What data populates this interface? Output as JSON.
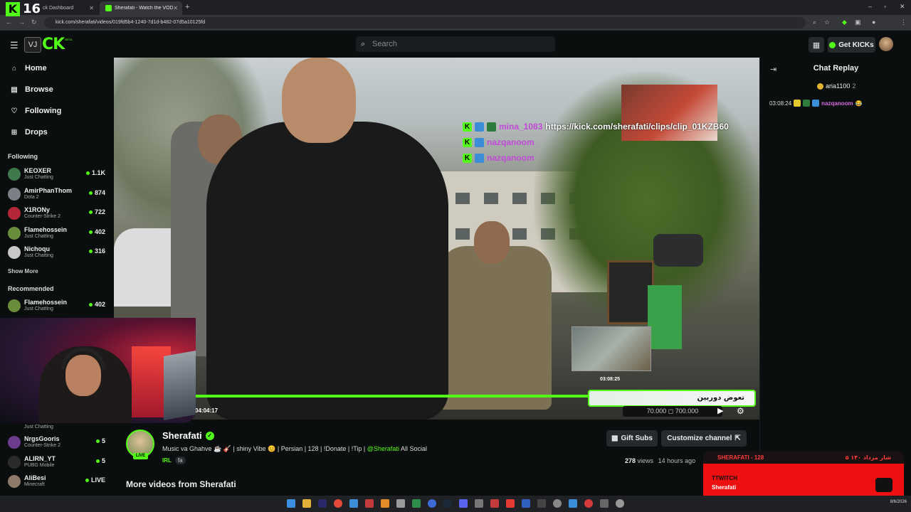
{
  "browser": {
    "tabs": [
      {
        "label": "Kick Dashboard",
        "partial": "ck Dashboard"
      },
      {
        "label": "Sherafati - Watch the VOD on Kick"
      }
    ],
    "address": "kick.com/sherafati/videos/019fd5b4-1240-7d1d-b482-07d5a10125fd",
    "overlay_number": "16"
  },
  "header": {
    "search_placeholder": "Search",
    "get_kicks": "Get KICKs",
    "logo_text": "CK",
    "logo_box": "VJ",
    "beta": "BETA"
  },
  "sidebar": {
    "nav": [
      {
        "label": "Home",
        "icon": "home-icon"
      },
      {
        "label": "Browse",
        "icon": "browse-icon"
      },
      {
        "label": "Following",
        "icon": "heart-icon"
      },
      {
        "label": "Drops",
        "icon": "drops-icon"
      }
    ],
    "following_title": "Following",
    "following": [
      {
        "name": "KEOXER",
        "category": "Just Chatting",
        "viewers": "1.1K"
      },
      {
        "name": "AmirPhanThom",
        "category": "Dota 2",
        "viewers": "874"
      },
      {
        "name": "X1RONy",
        "category": "Counter-Strike 2",
        "viewers": "722"
      },
      {
        "name": "Flamehossein",
        "category": "Just Chatting",
        "viewers": "402"
      },
      {
        "name": "Nichoqu",
        "category": "Just Chatting",
        "viewers": "316"
      }
    ],
    "show_more": "Show More",
    "recommended_title": "Recommended",
    "recommended": [
      {
        "name": "Flamehossein",
        "category": "Just Chatting",
        "viewers": "402"
      }
    ],
    "lower": [
      {
        "name": "",
        "category": "Just Chatting",
        "viewers": ""
      },
      {
        "name": "NrgsGooris",
        "category": "Counter-Strike 2",
        "viewers": "5"
      },
      {
        "name": "ALIRN_YT",
        "category": "PUBG Mobile",
        "viewers": "5"
      },
      {
        "name": "AliBesi",
        "category": "Minecraft",
        "viewers": "LIVE"
      }
    ]
  },
  "video": {
    "overlay_chat": [
      {
        "user": "mina_1083",
        "text": "https://kick.com/sherafati/clips/clip_01KZB60"
      },
      {
        "user": "nazqanoom",
        "text": ""
      },
      {
        "user": "nazqanoom",
        "text": ""
      }
    ],
    "thumb_time": "03:08:25",
    "current_time": "04:04:17",
    "progress": 0.75,
    "banner_text": "تعوض دوربین",
    "banner_sub": "70.000 ◻ 700.000"
  },
  "channel": {
    "name": "Sherafati",
    "live_badge": "LIVE",
    "title_main": "Music va Ghahve ☕ 🎸 | shiny Vibe 😊 | Persian | 128 | !Donate | !Tip | ",
    "title_mention": "@Sherafati",
    "title_tail": " All Social",
    "tag_lang": "IRL",
    "tag_fa": "fa",
    "gift_subs": "Gift Subs",
    "customize": "Customize channel",
    "views_count": "278",
    "views_label": "views",
    "ago": "14 hours ago",
    "more_videos": "More videos from Sherafati"
  },
  "notification": {
    "top_left": "SHERAFATI - 128",
    "top_right": "۵ شار مرداد ۱۴۰",
    "line1": "TTWITCH",
    "line2": "Sherafati"
  },
  "chat": {
    "title": "Chat Replay",
    "pinned_user": "aria1100",
    "pinned_count": "2",
    "messages": [
      {
        "time": "03:08:24",
        "user": "nazqanoom",
        "text": "😂"
      }
    ]
  },
  "taskbar": {
    "date": "8/6/2026"
  },
  "colors": {
    "accent": "#53fc18",
    "background": "#0b0e0f",
    "notif_red": "#ee1010"
  }
}
